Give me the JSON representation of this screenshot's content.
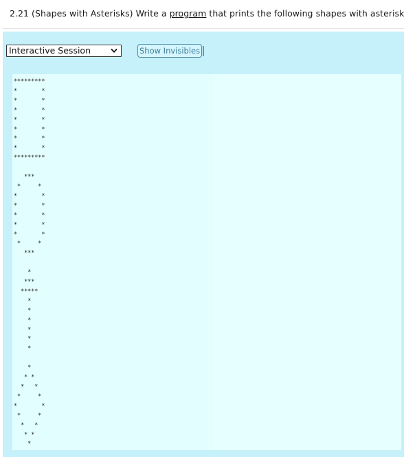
{
  "question": {
    "prefix": "2.21 (Shapes with Asterisks) Write a ",
    "link_text": "program",
    "suffix": " that prints the following shapes with asterisks."
  },
  "toolbar": {
    "session_select_value": "Interactive Session",
    "show_invisibles_label": "Show Invisibles"
  },
  "output": {
    "text": "*********\n*       *\n*       *\n*       *\n*       *\n*       *\n*       *\n*       *\n*********\n\n   ***\n *     *\n*       *\n*       *\n*       *\n*       *\n*       *\n *     *\n   ***\n\n    *\n   ***\n  *****\n    *\n    *\n    *\n    *\n    *\n    *\n\n    *\n   * *\n  *   *\n *     *\n*       *\n *     *\n  *   *\n   * *\n    *"
  },
  "colors": {
    "panel_bg": "#c6f1fb",
    "output_bg": "#e3fefe",
    "button_border": "#4a8aa3",
    "button_text": "#3a7d97"
  },
  "icons": {
    "select_chevron": "chevron-down-icon"
  }
}
